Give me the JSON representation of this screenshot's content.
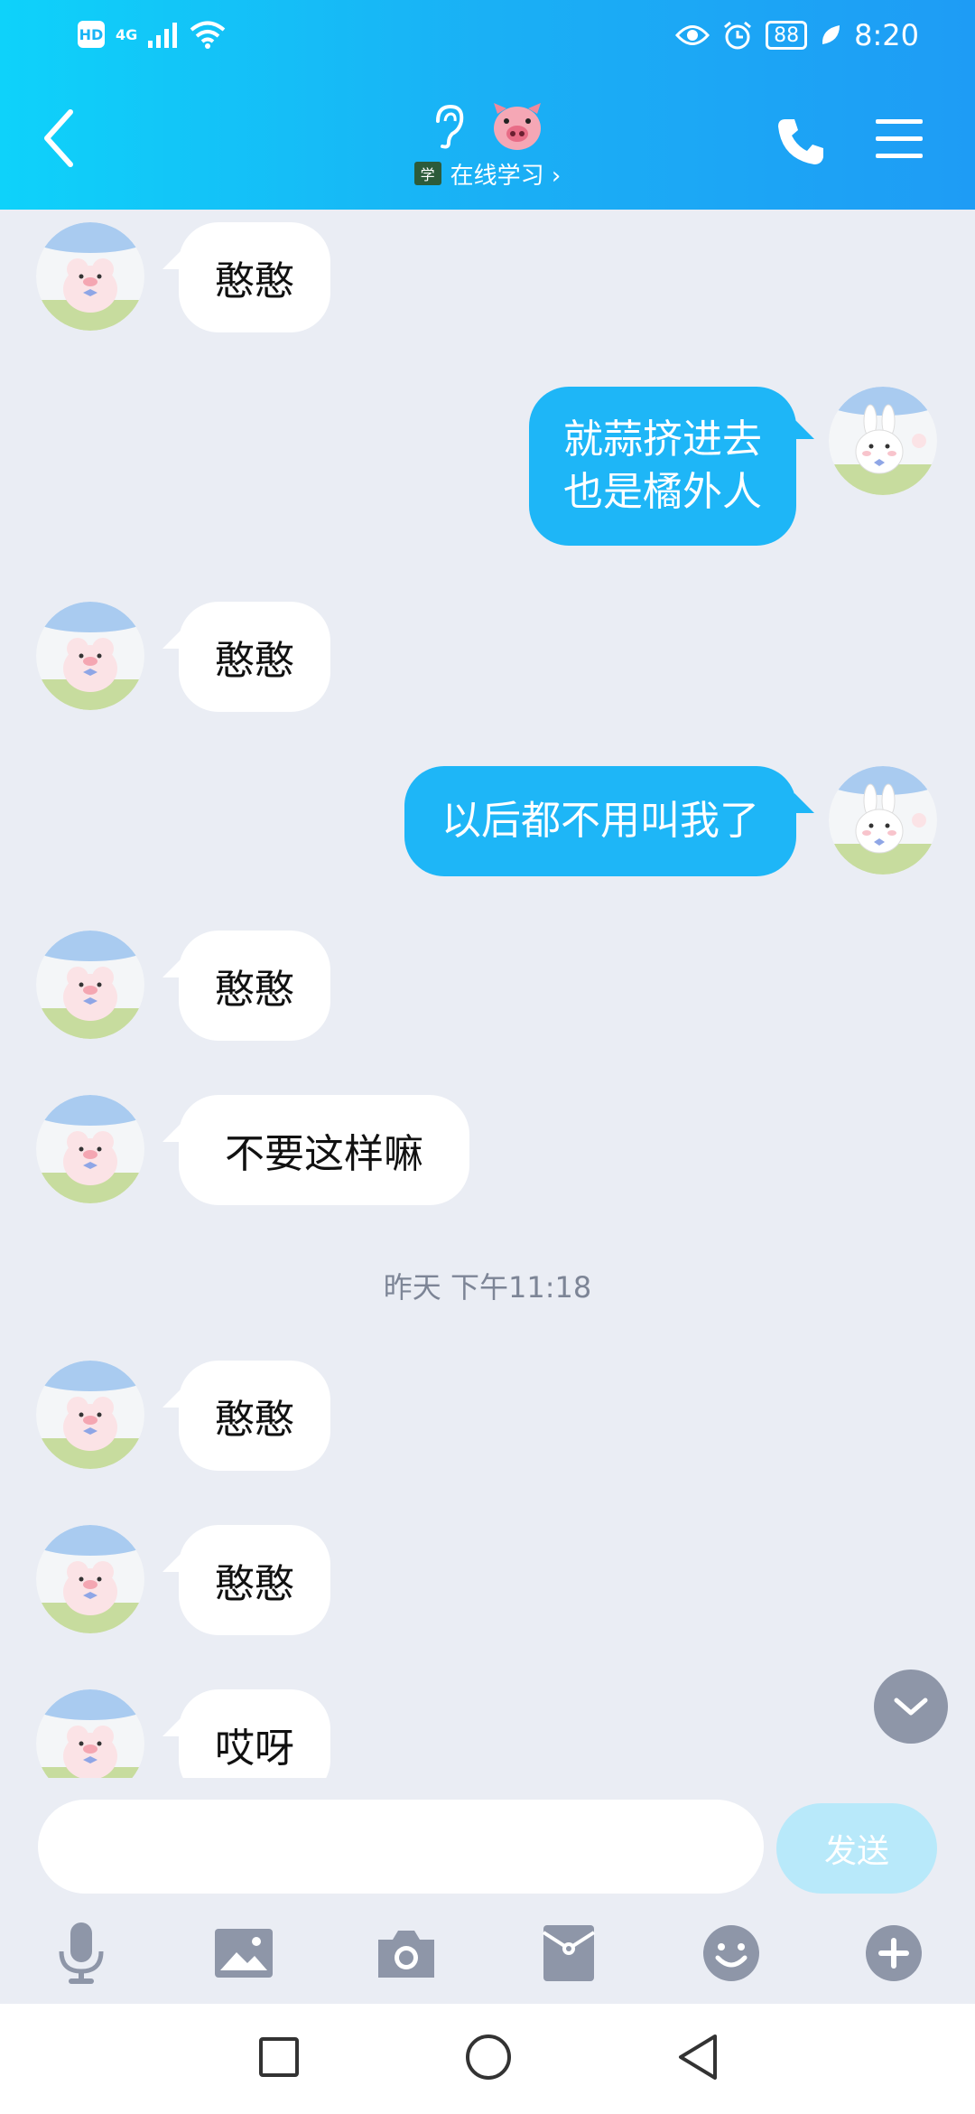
{
  "status_bar": {
    "network": "HD",
    "signal": "4G",
    "battery": "88",
    "time": "8:20"
  },
  "header": {
    "back_icon": "chevron-left-icon",
    "title_icons": [
      "ear-icon",
      "pig-face-icon"
    ],
    "subtitle_badge": "学",
    "subtitle": "在线学习 ›",
    "phone_icon": "phone-icon",
    "menu_icon": "hamburger-icon"
  },
  "messages": [
    {
      "side": "in",
      "text": "憨憨"
    },
    {
      "side": "out",
      "lines": [
        "就蒜挤进去",
        "也是橘外人"
      ]
    },
    {
      "side": "in",
      "text": "憨憨"
    },
    {
      "side": "out",
      "text": "以后都不用叫我了"
    },
    {
      "side": "in",
      "text": "憨憨"
    },
    {
      "side": "in",
      "text": "不要这样嘛"
    },
    {
      "timestamp": "昨天  下午11:18"
    },
    {
      "side": "in",
      "text": "憨憨"
    },
    {
      "side": "in",
      "text": "憨憨"
    },
    {
      "side": "in",
      "text": "哎呀"
    }
  ],
  "input": {
    "placeholder": "",
    "value": "",
    "send_label": "发送"
  },
  "toolbar_icons": [
    "microphone-icon",
    "image-icon",
    "camera-icon",
    "red-packet-icon",
    "emoji-icon",
    "plus-icon"
  ],
  "nav_icons": [
    "recent-apps-icon",
    "home-icon",
    "back-triangle-icon"
  ],
  "colors": {
    "accent": "#1eb6f7",
    "header_start": "#0ed2fa",
    "header_end": "#1e9cf5",
    "chat_bg": "#eaedf4",
    "icon_gray": "#8e96a8"
  }
}
